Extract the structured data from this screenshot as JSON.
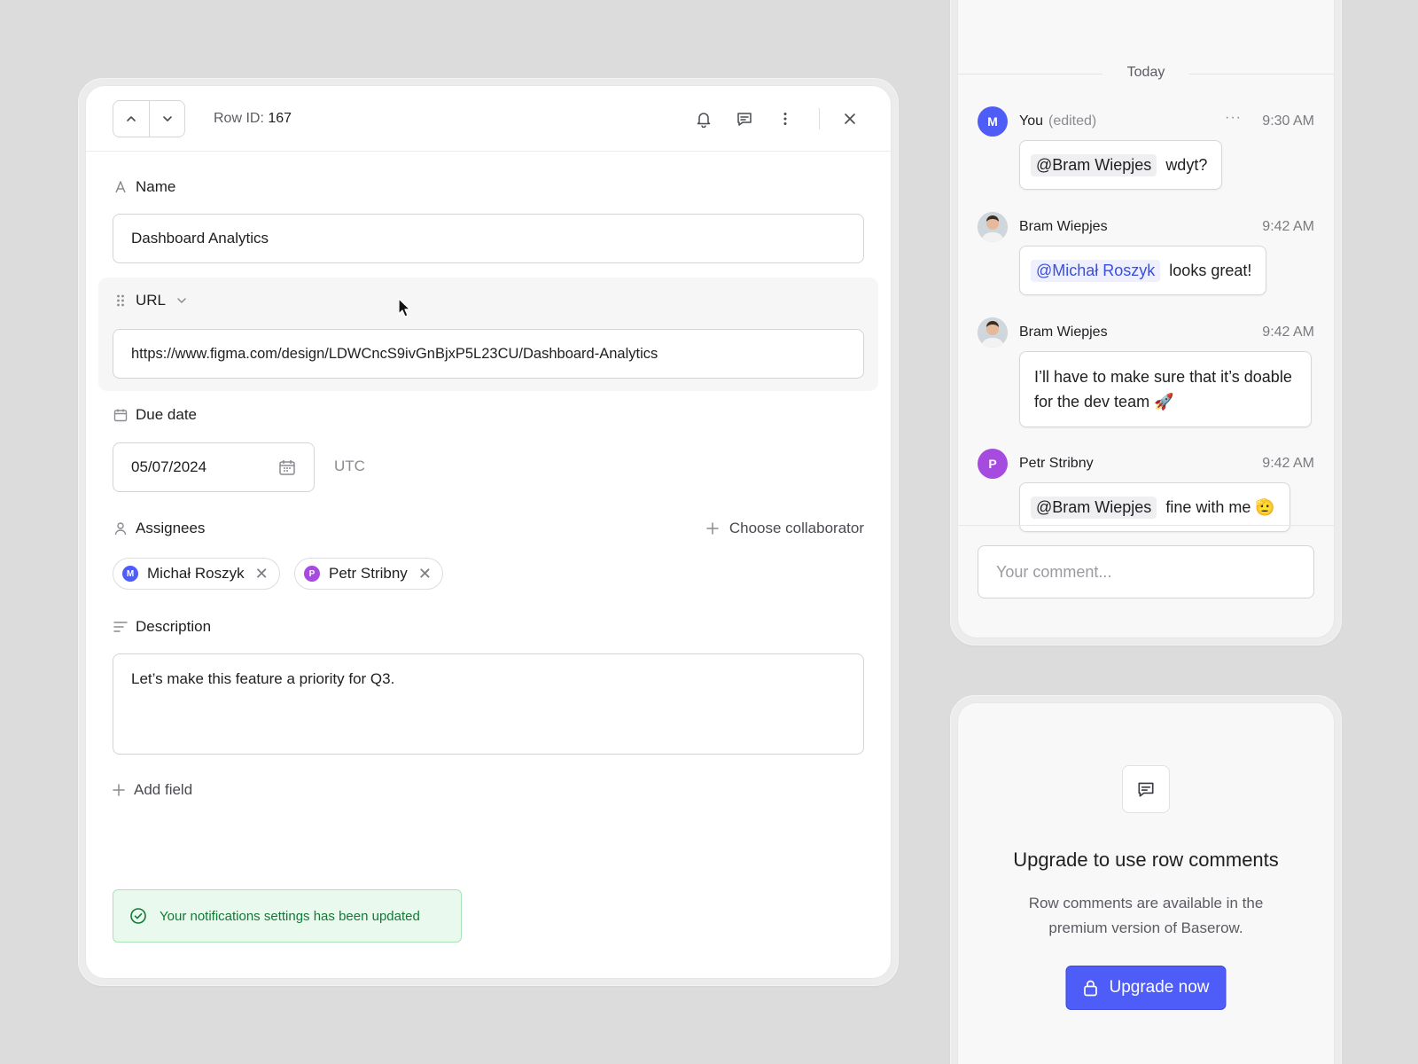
{
  "row_modal": {
    "row_id_label": "Row ID:",
    "row_id_value": "167",
    "fields": {
      "name": {
        "label": "Name",
        "value": "Dashboard Analytics"
      },
      "url": {
        "label": "URL",
        "value": "https://www.figma.com/design/LDWCncS9ivGnBjxP5L23CU/Dashboard-Analytics"
      },
      "due_date": {
        "label": "Due date",
        "value": "05/07/2024",
        "timezone": "UTC"
      },
      "assignees": {
        "label": "Assignees",
        "choose_label": "Choose collaborator",
        "chips": [
          {
            "initial": "M",
            "name": "Michał Roszyk",
            "color": "#4e5cf8"
          },
          {
            "initial": "P",
            "name": "Petr Stribny",
            "color": "#a64bdf"
          }
        ]
      },
      "description": {
        "label": "Description",
        "value": "Let’s make this feature a priority for Q3."
      }
    },
    "add_field_label": "Add field",
    "toast": "Your notifications settings has been updated"
  },
  "comments": {
    "date_divider": "Today",
    "items": [
      {
        "initial": "M",
        "author": "You",
        "edited": "(edited)",
        "more": "···",
        "time": "9:30 AM",
        "mention": "@Bram Wiepjes",
        "text": "wdyt?",
        "avatar_color": "#4e5cf8"
      },
      {
        "initial": "",
        "author": "Bram Wiepjes",
        "time": "9:42 AM",
        "mention": "@Michał Roszyk",
        "text": "looks great!"
      },
      {
        "initial": "",
        "author": "Bram Wiepjes",
        "time": "9:42 AM",
        "text": "I’ll have to make sure that it’s doable for the dev team 🚀"
      },
      {
        "initial": "P",
        "author": "Petr Stribny",
        "time": "9:42 AM",
        "mention": "@Bram Wiepjes",
        "text": "fine with me 🫡",
        "avatar_color": "#a64bdf"
      }
    ],
    "input_placeholder": "Your comment..."
  },
  "upgrade": {
    "title": "Upgrade to use row comments",
    "text": "Row comments are available in the premium version of Baserow.",
    "button_label": "Upgrade now"
  },
  "colors": {
    "accent": "#4e5cf8",
    "success_bg": "#eaf9ee",
    "success_text": "#107a34"
  }
}
